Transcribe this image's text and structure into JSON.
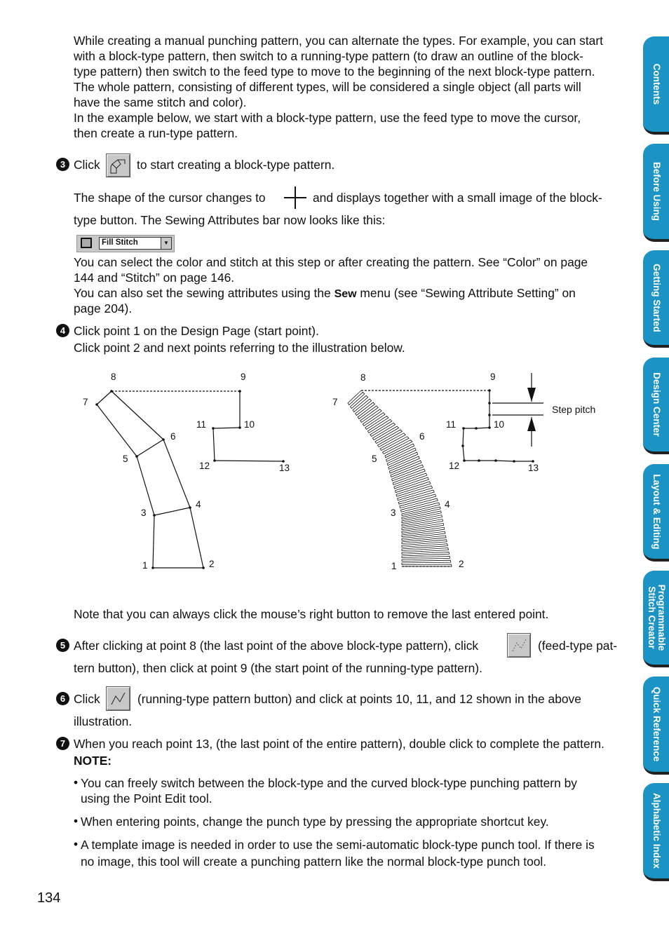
{
  "intro": [
    "While creating a manual punching pattern, you can alternate the types. For example, you can start",
    "with a block-type pattern, then switch to a running-type pattern (to draw an outline of the block-",
    "type pattern) then switch to the feed type to move to the beginning of the next block-type pattern.",
    "The whole pattern, consisting of different types, will be considered a single object (all parts will",
    "have the same stitch and color).",
    "In the example below, we start with a block-type pattern, use the feed type to move the cursor,",
    "then create a run-type pattern."
  ],
  "step3": {
    "num": "3",
    "pre": "Click",
    "post": "to start creating a block-type pattern.",
    "icon": "block-type-button-icon"
  },
  "cursor": {
    "pre": "The shape of the cursor changes to",
    "post": "and displays together with a small image of the block-",
    "line2": "type button. The Sewing Attributes bar now looks like this:",
    "icon": "crosshair-icon"
  },
  "attr_bar": {
    "select_value": "Fill Stitch"
  },
  "attr_text": [
    "You can select the color and stitch at this step or after creating the pattern. See “Color” on page",
    "144 and “Stitch” on page 146."
  ],
  "sew_line": {
    "pre": "You can also set the sewing attributes using the ",
    "bold": "Sew",
    "post": " menu (see “Sewing Attribute Setting” on",
    "line2": "page 204)."
  },
  "step4": {
    "num": "4",
    "line1": "Click point 1 on the Design Page (start point).",
    "line2": "Click point 2 and next points referring to the illustration below."
  },
  "diagram": {
    "points": [
      "1",
      "2",
      "3",
      "4",
      "5",
      "6",
      "7",
      "8",
      "9",
      "10",
      "11",
      "12",
      "13"
    ],
    "step_pitch": "Step pitch"
  },
  "note_line": "Note that you can always click the mouse’s right button to remove the last entered point.",
  "step5": {
    "num": "5",
    "pre": "After clicking at point 8 (the last point of the above block-type pattern), click",
    "post": "(feed-type pat-",
    "line2": "tern button), then click at point 9 (the start point of the running-type pattern).",
    "icon": "feed-type-button-icon"
  },
  "step6": {
    "num": "6",
    "pre": "Click",
    "post": "(running-type pattern button) and click at points 10, 11, and 12 shown in the above",
    "line2": "illustration.",
    "icon": "running-type-button-icon"
  },
  "step7": {
    "num": "7",
    "text": "When you reach point 13, (the last point of the entire pattern), double click to complete the pattern."
  },
  "note": {
    "title": "NOTE:",
    "bullets": [
      [
        "You can freely switch between the block-type and the curved block-type punching pattern by",
        "using the Point Edit tool."
      ],
      [
        "When entering points, change the punch type by pressing the appropriate shortcut key."
      ],
      [
        "A template image is needed in order to use the semi-automatic block-type punch tool. If there is",
        "no image, this tool will create a punching pattern like the normal block-type punch tool."
      ]
    ]
  },
  "page_number": "134",
  "tabs": [
    "Contents",
    "Before Using",
    "Getting Started",
    "Design Center",
    "Layout & Editing",
    "Programmable Stitch Creator",
    "Quick Reference",
    "Alphabetic Index"
  ],
  "colors": {
    "tab": "#1b93c4"
  }
}
